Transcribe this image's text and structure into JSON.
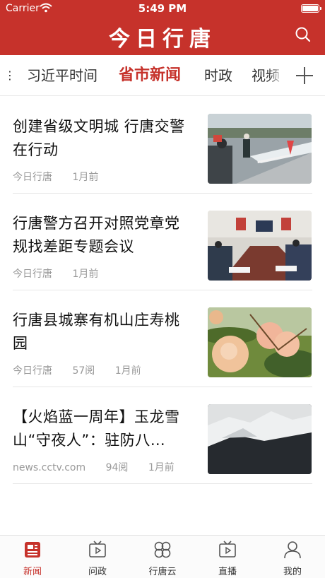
{
  "status_bar": {
    "carrier": "Carrier",
    "time": "5:49 PM"
  },
  "header": {
    "title": "今日行唐",
    "search_icon": "search-icon"
  },
  "tabs": {
    "items": [
      {
        "label": "习近平时间"
      },
      {
        "label": "省市新闻",
        "active": true
      },
      {
        "label": "时政"
      },
      {
        "label": "视频"
      }
    ],
    "add_icon": "plus-icon"
  },
  "news": [
    {
      "title": "创建省级文明城 行唐交警在行动",
      "source": "今日行唐",
      "reads": "",
      "time": "1月前"
    },
    {
      "title": "行唐警方召开对照党章党规找差距专题会议",
      "source": "今日行唐",
      "reads": "",
      "time": "1月前"
    },
    {
      "title": "行唐县城寨有机山庄寿桃园",
      "source": "今日行唐",
      "reads": "57阅",
      "time": "1月前"
    },
    {
      "title": "【火焰蓝一周年】玉龙雪山“守夜人”：驻防八…",
      "source": "news.cctv.com",
      "reads": "94阅",
      "time": "1月前"
    }
  ],
  "bottom_nav": [
    {
      "label": "新闻",
      "icon": "news-icon",
      "active": true
    },
    {
      "label": "问政",
      "icon": "tv-icon"
    },
    {
      "label": "行唐云",
      "icon": "cloud-grid-icon"
    },
    {
      "label": "直播",
      "icon": "live-tv-icon"
    },
    {
      "label": "我的",
      "icon": "user-icon"
    }
  ],
  "colors": {
    "brand": "#c6322b",
    "text": "#111111",
    "meta": "#999999"
  }
}
